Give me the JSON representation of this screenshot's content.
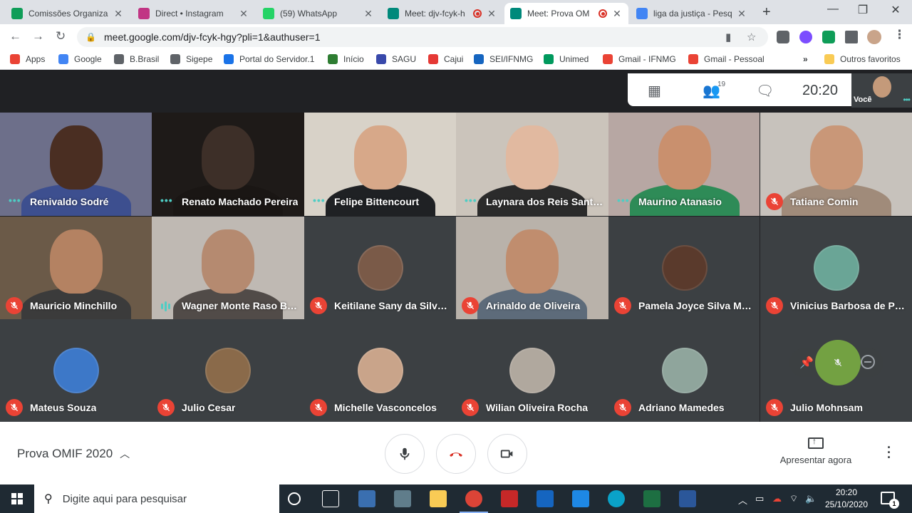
{
  "browser": {
    "tabs": [
      {
        "title": "Comissões Organiza",
        "icon": "sheets-icon",
        "color": "#0f9d58",
        "active": false
      },
      {
        "title": "Direct • Instagram",
        "icon": "instagram-icon",
        "color": "#c13584",
        "active": false
      },
      {
        "title": "(59) WhatsApp",
        "icon": "whatsapp-icon",
        "color": "#25d366",
        "active": false
      },
      {
        "title": "Meet: djv-fcyk-h",
        "icon": "meet-icon",
        "color": "#00897b",
        "active": false
      },
      {
        "title": "Meet: Prova OM",
        "icon": "meet-icon",
        "color": "#00897b",
        "active": true
      },
      {
        "title": "liga da justiça - Pesq",
        "icon": "google-icon",
        "color": "#4285f4",
        "active": false
      }
    ],
    "url": "meet.google.com/djv-fcyk-hgy?pli=1&authuser=1",
    "bookmarks": [
      {
        "label": "Apps",
        "icon": "apps-grid-icon",
        "color": "#ea4335"
      },
      {
        "label": "Google",
        "icon": "google-icon",
        "color": "#4285f4"
      },
      {
        "label": "B.Brasil",
        "icon": "globe-icon",
        "color": "#5f6368"
      },
      {
        "label": "Sigepe",
        "icon": "globe-icon",
        "color": "#5f6368"
      },
      {
        "label": "Portal do Servidor.1",
        "icon": "portal-icon",
        "color": "#1a73e8"
      },
      {
        "label": "Início",
        "icon": "ifnmg-icon",
        "color": "#2e7d32"
      },
      {
        "label": "SAGU",
        "icon": "sagu-icon",
        "color": "#3949ab"
      },
      {
        "label": "Cajui",
        "icon": "cajui-icon",
        "color": "#e53935"
      },
      {
        "label": "SEI/IFNMG",
        "icon": "sei-icon",
        "color": "#1565c0"
      },
      {
        "label": "Unimed",
        "icon": "unimed-icon",
        "color": "#00995d"
      },
      {
        "label": "Gmail - IFNMG",
        "icon": "gmail-icon",
        "color": "#ea4335"
      },
      {
        "label": "Gmail - Pessoal",
        "icon": "gmail-icon",
        "color": "#ea4335"
      }
    ],
    "other_bookmarks": "Outros favoritos",
    "more_bookmarks": "»"
  },
  "meet": {
    "participant_count": "19",
    "time": "20:20",
    "self_label": "Você",
    "meeting_name": "Prova OMIF 2020",
    "present_label": "Apresentar agora",
    "participants": [
      {
        "name": "Renivaldo Sodré",
        "status": "dots",
        "type": "video",
        "bg": "#6d6f8a",
        "skin": "#4a2e22",
        "shirt": "#3d4f8f"
      },
      {
        "name": "Renato Machado Pereira",
        "status": "dots",
        "type": "video",
        "bg": "#1e1a18",
        "skin": "#3d2f28",
        "shirt": "#1a1614"
      },
      {
        "name": "Felipe Bittencourt",
        "status": "dots",
        "type": "video",
        "bg": "#d8d2c8",
        "skin": "#d7a889",
        "shirt": "#1f2124"
      },
      {
        "name": "Laynara dos Reis Santos...",
        "status": "dots",
        "type": "video",
        "bg": "#cbc4bb",
        "skin": "#e1b9a0",
        "shirt": "#2b2b2b"
      },
      {
        "name": "Maurino Atanasio",
        "status": "dots",
        "type": "video",
        "bg": "#b7a7a3",
        "skin": "#c9906e",
        "shirt": "#2e8b57"
      },
      {
        "name": "Tatiane Comin",
        "status": "muted",
        "type": "video",
        "bg": "#c7c2bc",
        "skin": "#c99778",
        "shirt": "#a08b7a"
      },
      {
        "name": "Mauricio Minchillo",
        "status": "muted",
        "type": "video",
        "bg": "#6b5a48",
        "skin": "#b48262",
        "shirt": "#3b3b3b"
      },
      {
        "name": "Wagner Monte Raso Bra...",
        "status": "speaking",
        "type": "video",
        "bg": "#bfb9b3",
        "skin": "#b58a70",
        "shirt": "#514b48"
      },
      {
        "name": "Keitilane Sany da Silveira",
        "status": "muted",
        "type": "avatar",
        "avatar": "#7a5a48"
      },
      {
        "name": "Arinaldo de Oliveira",
        "status": "muted",
        "type": "video",
        "bg": "#b9b2aa",
        "skin": "#c08d6e",
        "shirt": "#5d6b7a"
      },
      {
        "name": "Pamela Joyce Silva Mel...",
        "status": "muted",
        "type": "avatar",
        "avatar": "#5a3a2c"
      },
      {
        "name": "Vinicius Barbosa de Paiva",
        "status": "muted",
        "type": "avatar",
        "avatar": "#6aa596"
      },
      {
        "name": "Mateus Souza",
        "status": "muted",
        "type": "avatar",
        "avatar": "#3d78c8"
      },
      {
        "name": "Julio Cesar",
        "status": "muted",
        "type": "avatar",
        "avatar": "#8a6a4a"
      },
      {
        "name": "Michelle Vasconcelos",
        "status": "muted",
        "type": "avatar",
        "avatar": "#c9a48a"
      },
      {
        "name": "Wilian Oliveira Rocha",
        "status": "muted",
        "type": "avatar",
        "avatar": "#b0a89e"
      },
      {
        "name": "Adriano Mamedes",
        "status": "muted",
        "type": "avatar",
        "avatar": "#8fa59c"
      },
      {
        "name": "Julio Mohnsam",
        "status": "muted",
        "type": "hover"
      }
    ]
  },
  "taskbar": {
    "search_placeholder": "Digite aqui para pesquisar",
    "time": "20:20",
    "date": "25/10/2020",
    "notifications": "1"
  }
}
